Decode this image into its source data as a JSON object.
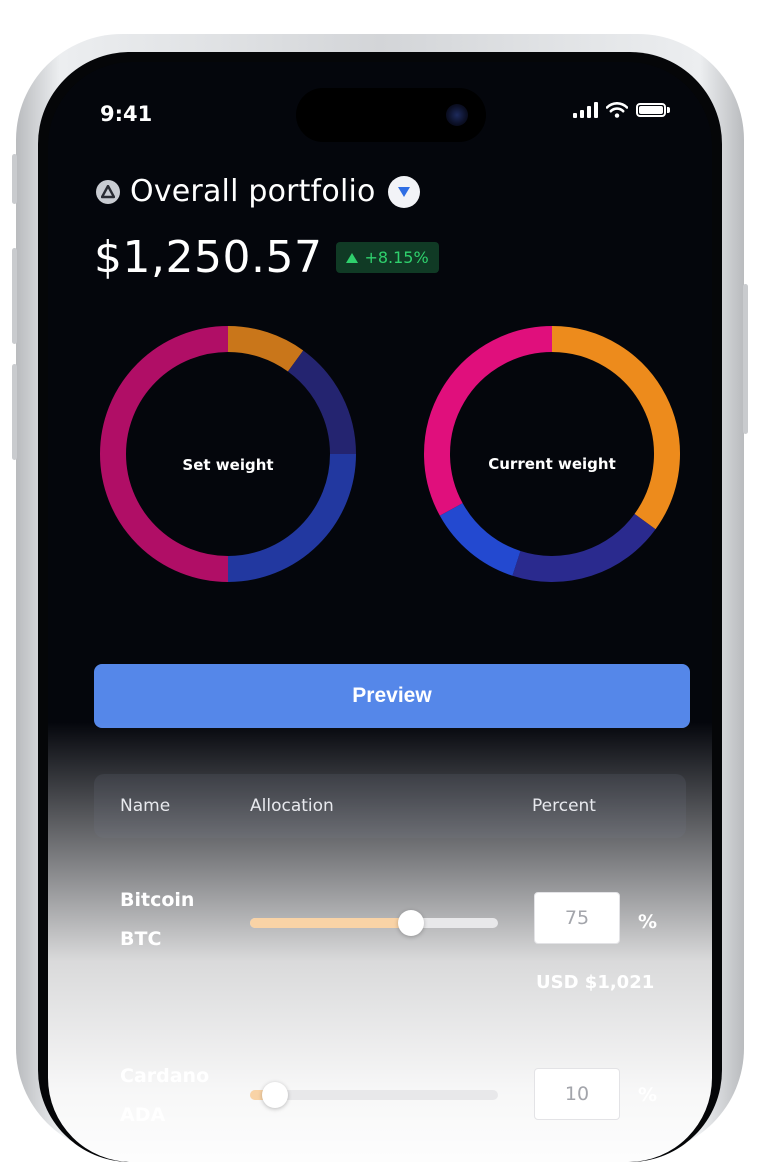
{
  "status_bar": {
    "time": "9:41"
  },
  "portfolio": {
    "title": "Overall portfolio",
    "balance": "$1,250.57",
    "change": "+8.15%",
    "change_color": "#2fd06d"
  },
  "charts": {
    "set_weight_label": "Set weight",
    "current_weight_label": "Current weight"
  },
  "chart_data": [
    {
      "type": "pie",
      "title": "Set weight",
      "values": [
        10,
        15,
        25,
        50
      ],
      "colors": [
        "#c9761a",
        "#242470",
        "#2238a0",
        "#b00e66"
      ]
    },
    {
      "type": "pie",
      "title": "Current weight",
      "values": [
        35,
        20,
        12,
        33
      ],
      "colors": [
        "#ed8b1c",
        "#2a2a8e",
        "#2349d0",
        "#e00f7c"
      ]
    }
  ],
  "preview_button_label": "Preview",
  "table": {
    "headers": {
      "name": "Name",
      "allocation": "Allocation",
      "percent": "Percent"
    },
    "rows": [
      {
        "name": "Bitcoin",
        "symbol": "BTC",
        "percent": "75",
        "percent_sign": "%",
        "usd": "USD $1,021",
        "allocation": 0.65
      },
      {
        "name": "Cardano",
        "symbol": "ADA",
        "percent": "10",
        "percent_sign": "%",
        "allocation": 0.1
      }
    ]
  }
}
